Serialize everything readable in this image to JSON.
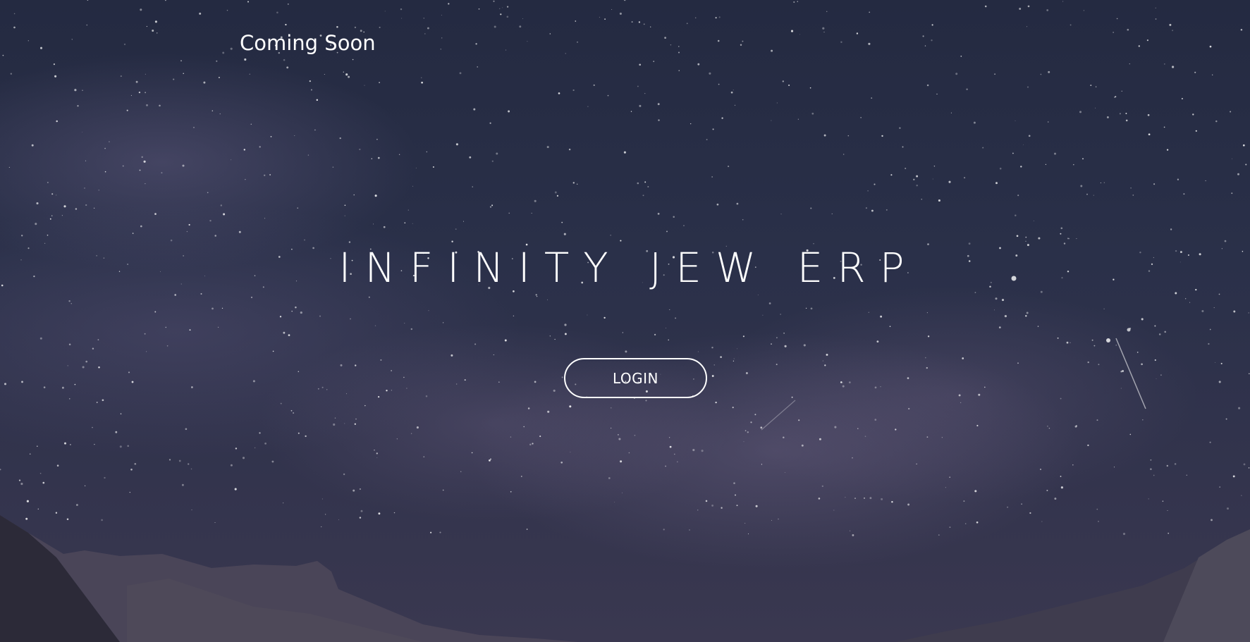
{
  "header": {
    "coming_soon_text": "Coming Soon"
  },
  "hero": {
    "title": "INFINITY JEW ERP",
    "login_button_label": "LOGIN"
  },
  "background": {
    "description_icon": "starry-night-sky-image",
    "sky_color": "#272d45",
    "text_color": "#ffffff"
  }
}
